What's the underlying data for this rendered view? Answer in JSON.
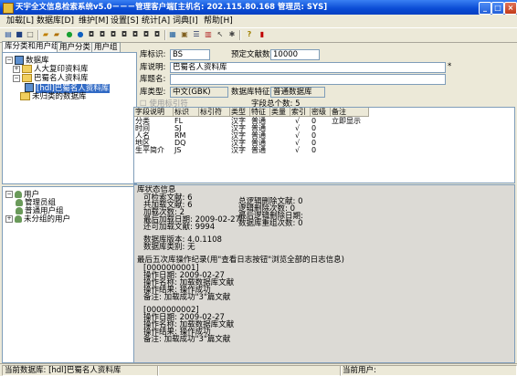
{
  "window": {
    "title": "天宇全文信息检索系统v5.0－－－管理客户端[主机名: 202.115.80.168    管理员: SYS]"
  },
  "menu": [
    "加载[L]",
    "数据库[D]",
    "维护[M]",
    "设置[S]",
    "统计[A]",
    "词典[I]",
    "帮助[H]"
  ],
  "toolbar_icons": [
    "database-icon",
    "save-icon",
    "new-icon",
    "open-icon",
    "folder-icon",
    "green-circle-icon",
    "blue-circle-icon",
    "record-icon",
    "record-icon",
    "record-icon",
    "record-icon",
    "record-icon",
    "record-icon",
    "record-icon",
    "grid-icon",
    "lock-icon",
    "list-icon",
    "chart-icon",
    "cursor-icon",
    "tools-icon",
    "help-icon",
    "delete-icon"
  ],
  "left_tabs": [
    "库分类和用户组",
    "用户分类",
    "用户组"
  ],
  "tree": {
    "root": "数据库",
    "items": [
      "人大复印资料库",
      "巴蜀名人资料库",
      "[hdl]巴蜀名人资料库",
      "未归类的数据库"
    ]
  },
  "user_tree": {
    "root": "用户",
    "items": [
      "管理员组",
      "普通用户组",
      "未分组的用户"
    ]
  },
  "form": {
    "lib_id_label": "库标识:",
    "lib_id": "BS",
    "preset_label": "预定文献数:",
    "preset": "10000",
    "desc_label": "库说明:",
    "desc": "巴蜀名人资料库",
    "title_label": "库题名:",
    "title": "",
    "type_label": "库类型:",
    "type": "中文(GBK)",
    "feature_label": "数据库特征:",
    "feature": "普通数据库",
    "mark_label": "使用标引符",
    "fields_count_label": "字段总个数:",
    "fields_count": "5",
    "required_mark": "*"
  },
  "grid": {
    "headers": [
      "字段说明",
      "标识",
      "标引符",
      "类型",
      "特征",
      "类量",
      "索引",
      "密级",
      "备注"
    ],
    "rows": [
      [
        "分类",
        "FL",
        "",
        "汉字",
        "普通",
        "",
        "√",
        "0",
        "立即显示"
      ],
      [
        "时间",
        "SJ",
        "",
        "汉字",
        "普通",
        "",
        "√",
        "0",
        ""
      ],
      [
        "人名",
        "RM",
        "",
        "汉字",
        "普通",
        "",
        "√",
        "0",
        ""
      ],
      [
        "地区",
        "DQ",
        "",
        "汉字",
        "普通",
        "",
        "√",
        "0",
        ""
      ],
      [
        "生平简介",
        "JS",
        "",
        "汉字",
        "普通",
        "",
        "√",
        "0",
        ""
      ]
    ]
  },
  "status_info": {
    "heading": "库状态信息",
    "left": [
      "可检索文献:    6",
      "共加载文献:    6",
      "加载次数:      2",
      "最后加载日期: 2009-02-27",
      "还可加载文献: 9994"
    ],
    "right": [
      "总逻辑删除文献:    0",
      "逻辑删除次数:      0",
      "最后逻辑删除日期:",
      "数据库重组次数:    0"
    ],
    "version": "数据库版本:  4.0.1108",
    "category": "数据库类别: 无",
    "log_title": "最后五次库操作纪录(用\"查看日志按钮\"浏览全部的日志信息)",
    "log1": [
      "[0000000001]",
      "操作日期: 2009-02-27",
      "操作名称: 加载数据库文献",
      "操作结果: 操作成功",
      "备注:      加载成功\"3\"篇文献"
    ],
    "log2": [
      "[0000000002]",
      "操作日期: 2009-02-27",
      "操作名称: 加载数据库文献",
      "操作结果: 操作成功",
      "备注:      加载成功\"3\"篇文献"
    ]
  },
  "statusbar": {
    "current_db": "当前数据库: [hdl]巴蜀名人资料库",
    "current_user": "当前用户:"
  }
}
